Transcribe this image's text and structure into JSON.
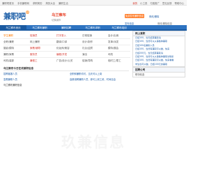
{
  "topbar": {
    "left_links": [
      "兼职吧首页",
      "手机兼职网",
      "求职简历",
      "简历大全",
      "兼职生活",
      "兼职线上"
    ],
    "right_links": [
      "我的",
      "小工具",
      "付费推广",
      "意见反馈",
      "帮助中心"
    ]
  },
  "header": {
    "logo_text": "兼职吧",
    "logo_mark": "®",
    "city_name": "乌兰察布",
    "city_sub": "切换城市",
    "publish_button": "免费发布兼职信息",
    "link_a": "修改/删除",
    "link_b": "发布信息",
    "manage_button": "修改/删除信息"
  },
  "nav": {
    "items": [
      "乌兰察布首页",
      "乌兰察布兼职",
      "兼职招聘",
      "乌兰察布求职",
      "乌兰察布培训"
    ]
  },
  "categories": {
    "rows": [
      [
        "学生兼职",
        "促销员",
        "打字录入",
        "日常促销",
        "会计/出纳"
      ],
      [
        "全职/兼职",
        "网上兼职",
        "翻译/口译",
        "设计/制作",
        "发单/派发"
      ],
      [
        "摄影/模特",
        "家教/辅导",
        "化妆师/美容",
        "礼仪/迎宾",
        "模特/展会"
      ],
      [
        "兼职/家教",
        "服务员",
        "编程/开发",
        "演出",
        "司机"
      ],
      [
        "司机/装卸",
        "暑假工",
        "广告/设计/公关",
        "促销/导购",
        "临时工/零工"
      ]
    ]
  },
  "side_panel": {
    "title_a": "网上兼职",
    "lines": [
      "日结100，当天结算兼职请",
      "日结100，当然可以从事各种兼职",
      "日结100名兼职人员",
      "日结100，当然有兼职可以做，快来",
      "日结200元，当天结算兼职请",
      "日结100，当然可以从事各种兼职请联系",
      "日结100，当然有兼职可以做，快来看看",
      "学生也可以做，日结100元的兼职"
    ],
    "title_b": "招聘公司",
    "text_b": "职场精选"
  },
  "list": {
    "head": "乌兰察布今日在线兼职信息",
    "rows": [
      {
        "left": "招聘客服人员",
        "right": "全职和兼职均可，当天可以上岗"
      },
      {
        "left": "急需兼职人员",
        "right": "高薪诚聘兼职人员，即可上岗工资，时间自由"
      },
      {
        "left": "乌兰察布兼职信息",
        "right": ""
      }
    ]
  },
  "watermark": "玖兼信息"
}
